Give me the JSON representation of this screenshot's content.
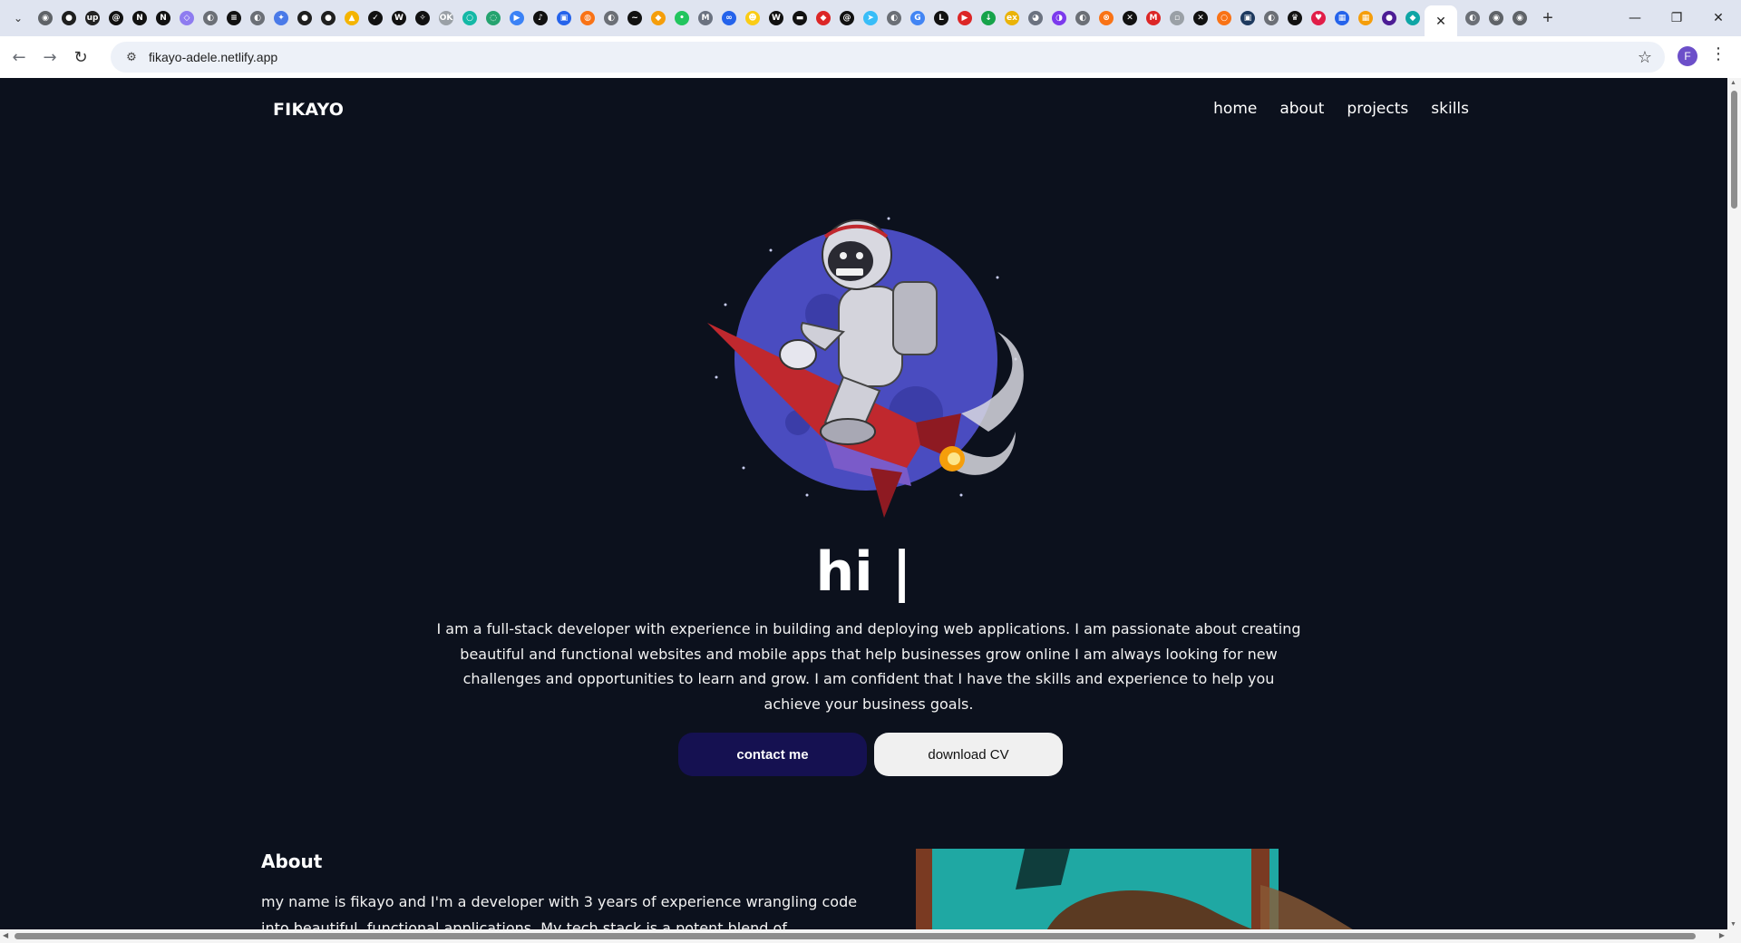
{
  "browser": {
    "tab_search_icon": "chevron-down-icon",
    "pinned_tabs": [
      {
        "icon": "chrome-icon",
        "color": "#5f6368",
        "glyph": "◉"
      },
      {
        "icon": "github-icon",
        "color": "#1f1f1f",
        "glyph": "●"
      },
      {
        "icon": "upwork-icon",
        "color": "#222222",
        "glyph": "up"
      },
      {
        "icon": "threads-icon",
        "color": "#111111",
        "glyph": "@"
      },
      {
        "icon": "notion-icon",
        "color": "#111111",
        "glyph": "N"
      },
      {
        "icon": "notion-icon",
        "color": "#111111",
        "glyph": "N"
      },
      {
        "icon": "cube-icon",
        "color": "#8e7cf0",
        "glyph": "◇"
      },
      {
        "icon": "globe-icon",
        "color": "#6b6f76",
        "glyph": "◐"
      },
      {
        "icon": "stack-icon",
        "color": "#111111",
        "glyph": "≡"
      },
      {
        "icon": "globe-icon",
        "color": "#6b6f76",
        "glyph": "◐"
      },
      {
        "icon": "gemini-icon",
        "color": "#4a7ae8",
        "glyph": "✦"
      },
      {
        "icon": "github-icon",
        "color": "#1f1f1f",
        "glyph": "●"
      },
      {
        "icon": "github-icon",
        "color": "#1f1f1f",
        "glyph": "●"
      },
      {
        "icon": "drive-icon",
        "color": "#f4b400",
        "glyph": "▲"
      },
      {
        "icon": "check-icon",
        "color": "#111111",
        "glyph": "✓"
      },
      {
        "icon": "wordmark-icon",
        "color": "#111111",
        "glyph": "W"
      },
      {
        "icon": "compass-icon",
        "color": "#111111",
        "glyph": "✧"
      },
      {
        "icon": "ok-icon",
        "color": "#9aa0a6",
        "glyph": "OK"
      },
      {
        "icon": "circle-icon",
        "color": "#14b8a6",
        "glyph": "○"
      },
      {
        "icon": "chat-icon",
        "color": "#25a36f",
        "glyph": "◌"
      },
      {
        "icon": "meet-icon",
        "color": "#3b82f6",
        "glyph": "▶"
      },
      {
        "icon": "tiktok-icon",
        "color": "#111111",
        "glyph": "♪"
      },
      {
        "icon": "zoom-icon",
        "color": "#2563eb",
        "glyph": "▣"
      },
      {
        "icon": "figma-icon",
        "color": "#f97316",
        "glyph": "◍"
      },
      {
        "icon": "globe-icon",
        "color": "#6b6f76",
        "glyph": "◐"
      },
      {
        "icon": "wave-icon",
        "color": "#111111",
        "glyph": "~"
      },
      {
        "icon": "bookmark-icon",
        "color": "#f59e0b",
        "glyph": "◆"
      },
      {
        "icon": "dot-icon",
        "color": "#22c55e",
        "glyph": "•"
      },
      {
        "icon": "m-icon",
        "color": "#6b7280",
        "glyph": "M"
      },
      {
        "icon": "meta-icon",
        "color": "#2563eb",
        "glyph": "∞"
      },
      {
        "icon": "bag-icon",
        "color": "#facc15",
        "glyph": "☻"
      },
      {
        "icon": "wiki-icon",
        "color": "#111111",
        "glyph": "W"
      },
      {
        "icon": "card-icon",
        "color": "#111111",
        "glyph": "▬"
      },
      {
        "icon": "patch-icon",
        "color": "#dc2626",
        "glyph": "◆"
      },
      {
        "icon": "threads-icon",
        "color": "#111111",
        "glyph": "@"
      },
      {
        "icon": "plane-icon",
        "color": "#38bdf8",
        "glyph": "➤"
      },
      {
        "icon": "globe-icon",
        "color": "#6b6f76",
        "glyph": "◐"
      },
      {
        "icon": "google-icon",
        "color": "#4285f4",
        "glyph": "G"
      },
      {
        "icon": "linkedin-icon",
        "color": "#111111",
        "glyph": "L"
      },
      {
        "icon": "youtube-icon",
        "color": "#dc2626",
        "glyph": "▶"
      },
      {
        "icon": "download-icon",
        "color": "#16a34a",
        "glyph": "↓"
      },
      {
        "icon": "ex-icon",
        "color": "#eab308",
        "glyph": "ex"
      },
      {
        "icon": "mask-icon",
        "color": "#6b7280",
        "glyph": "◕"
      },
      {
        "icon": "swirl-icon",
        "color": "#7c3aed",
        "glyph": "◑"
      },
      {
        "icon": "globe-icon",
        "color": "#6b6f76",
        "glyph": "◐"
      },
      {
        "icon": "x-circle-icon",
        "color": "#f97316",
        "glyph": "⊗"
      },
      {
        "icon": "x-icon",
        "color": "#111111",
        "glyph": "✕"
      },
      {
        "icon": "gmail-icon",
        "color": "#dc2626",
        "glyph": "M"
      },
      {
        "icon": "broken-image-icon",
        "color": "#9aa0a6",
        "glyph": "▫"
      },
      {
        "icon": "x-icon",
        "color": "#111111",
        "glyph": "✕"
      },
      {
        "icon": "ring-icon",
        "color": "#f97316",
        "glyph": "○"
      },
      {
        "icon": "terminal-icon",
        "color": "#1e3a5f",
        "glyph": "▣"
      },
      {
        "icon": "globe-icon",
        "color": "#6b6f76",
        "glyph": "◐"
      },
      {
        "icon": "crown-icon",
        "color": "#111111",
        "glyph": "♛"
      },
      {
        "icon": "heart-icon",
        "color": "#e11d48",
        "glyph": "♥"
      },
      {
        "icon": "panel-icon",
        "color": "#2563eb",
        "glyph": "▦"
      },
      {
        "icon": "grid-icon",
        "color": "#f59e0b",
        "glyph": "▦"
      },
      {
        "icon": "orb-icon",
        "color": "#4c1d95",
        "glyph": "●"
      },
      {
        "icon": "diamond-icon",
        "color": "#0ea5a5",
        "glyph": "◆"
      }
    ],
    "active_tab_close_icon": "close-icon",
    "trailing_tabs": [
      {
        "icon": "globe-icon",
        "color": "#6b6f76",
        "glyph": "◐"
      },
      {
        "icon": "chrome-icon",
        "color": "#5f6368",
        "glyph": "◉"
      },
      {
        "icon": "chrome-icon",
        "color": "#5f6368",
        "glyph": "◉"
      }
    ],
    "new_tab_icon": "plus-icon",
    "url": "fikayo-adele.netlify.app",
    "profile_initial": "F"
  },
  "site": {
    "logo": "FIKAYO",
    "nav": [
      "home",
      "about",
      "projects",
      "skills"
    ],
    "hero": {
      "image": "astronaut-riding-rocket",
      "title": "hi |",
      "bio": "I am a full-stack developer with experience in building and deploying web applications. I am passionate about creating beautiful and functional websites and mobile apps that help businesses grow online I am always looking for new challenges and opportunities to learn and grow. I am confident that I have the skills and experience to help you achieve your business goals.",
      "primary_button": "contact me",
      "secondary_button": "download CV"
    },
    "about": {
      "title": "About",
      "text": "my name is fikayo and I'm a developer with 3 years of experience wrangling code into beautiful, functional applications. My tech stack is a potent blend of",
      "image": "portrait-photo-teal-background"
    }
  },
  "colors": {
    "page_background": "#0c111d",
    "primary_button": "#151151",
    "secondary_button": "#f0f0f0",
    "planet": "#4a4cc0",
    "rocket": "#c0282e"
  }
}
